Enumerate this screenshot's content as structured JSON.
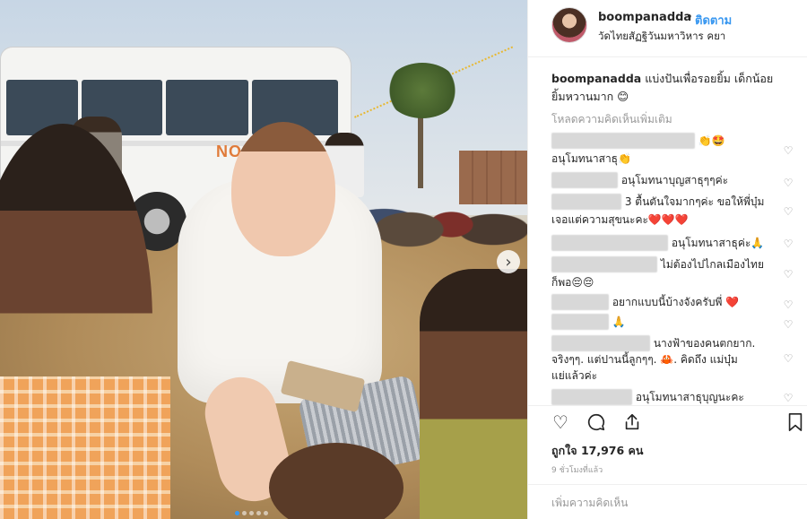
{
  "post": {
    "username": "boompanadda",
    "separator": "•",
    "follow_label": "ติดตาม",
    "location": "วัดไทยสัฏฐิวันมหาวิหาร คยา"
  },
  "caption": {
    "username": "boompanadda",
    "text": "แบ่งปันเพื่อรอยยิ้ม เด็กน้อยยิ้มหวานมาก 😊"
  },
  "load_more_label": "โหลดความคิดเห็นเพิ่มเติม",
  "comments": [
    {
      "text": "👏🤩"
    },
    {
      "text": "อนุโมทนาสาธุ👏"
    },
    {
      "text": "อนุโมทนาบุญสาธุๆๆค่ะ"
    },
    {
      "text": "3 ตื้นตันใจมากๆค่ะ ขอให้พี่บุ๋ม"
    },
    {
      "text": "เจอแต่ความสุขนะคะ❤️❤️❤️"
    },
    {
      "text": "อนุโมทนาสาธุค่ะ🙏"
    },
    {
      "text": "ไม่ต้องไปไกลเมืองไทย"
    },
    {
      "text": "ก็พอ😔😔"
    },
    {
      "text": "อยากแบบนี้บ้างจังครับพี่ ❤️"
    },
    {
      "text": "🙏"
    },
    {
      "text": "นางฟ้าของคนตกยาก."
    },
    {
      "text": "จริงๆๆ. แต่ปานนี้ลูกๆๆ. 🦀. คิดถึง แม่บุ๋ม"
    },
    {
      "text": "แย่แล้วค่ะ"
    },
    {
      "text": "อนุโมทนาสาธุบุญนะคะ"
    }
  ],
  "likes": {
    "label": "ถูกใจ",
    "count": "17,976",
    "unit": "คน"
  },
  "time_ago": "9 ชั่วโมงที่แล้ว",
  "add_comment_placeholder": "เพิ่มความคิดเห็น",
  "icons": {
    "heart": "heart-icon",
    "comment": "comment-icon",
    "share": "share-icon",
    "bookmark": "bookmark-icon",
    "next": "chevron-right-icon"
  },
  "colors": {
    "link_blue": "#3897f0",
    "muted": "#999999",
    "text": "#262626"
  },
  "carousel": {
    "slide_count": 5,
    "active_index": 0
  }
}
